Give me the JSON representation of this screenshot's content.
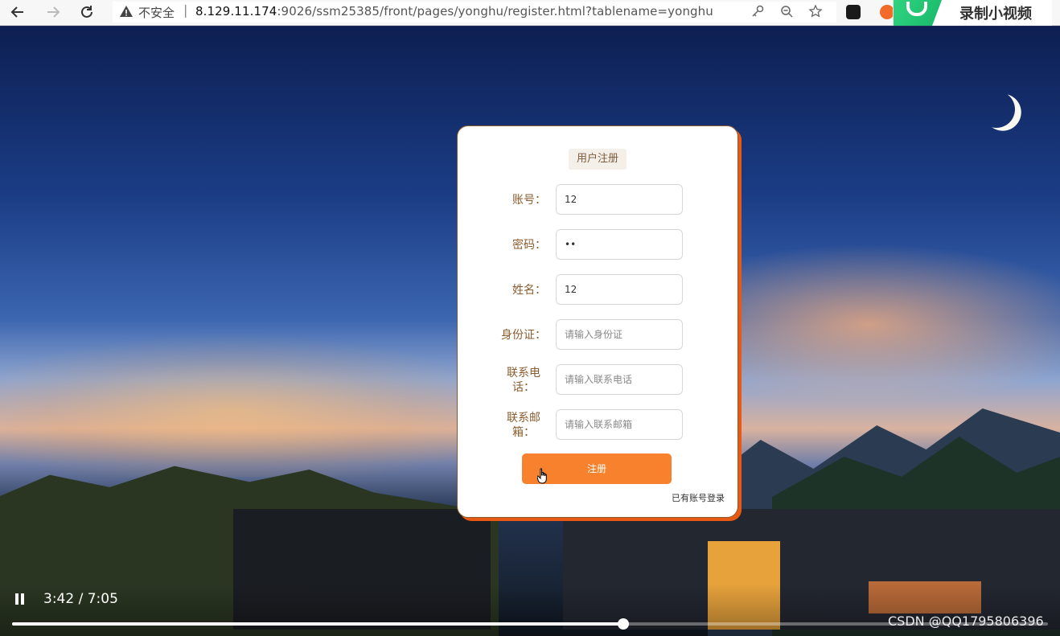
{
  "browser": {
    "back_icon": "arrow-left-icon",
    "forward_icon": "arrow-right-icon",
    "reload_icon": "reload-icon",
    "security_label": "不安全",
    "url_host": "8.129.11.174",
    "url_rest": ":9026/ssm25385/front/pages/yonghu/register.html?tablename=yonghu",
    "recorder_title": "录制小视频"
  },
  "form": {
    "title": "用户注册",
    "fields": [
      {
        "label": "账号：",
        "value": "12",
        "placeholder": ""
      },
      {
        "label": "密码：",
        "value": "••",
        "placeholder": ""
      },
      {
        "label": "姓名：",
        "value": "12",
        "placeholder": ""
      },
      {
        "label": "身份证：",
        "value": "",
        "placeholder": "请输入身份证"
      },
      {
        "label_line1": "联系电",
        "label_line2": "话：",
        "value": "",
        "placeholder": "请输入联系电话"
      },
      {
        "label_line1": "联系邮",
        "label_line2": "箱：",
        "value": "",
        "placeholder": "请输入联系邮箱"
      }
    ],
    "submit_label": "注册",
    "login_link": "已有账号登录"
  },
  "video": {
    "time": "3:42 / 7:05",
    "progress": 0.59,
    "watermark": "CSDN @QQ1795806396"
  },
  "colors": {
    "accent": "#f7812c",
    "card_shadow": "#e85a13",
    "label": "#8a5c2f"
  }
}
